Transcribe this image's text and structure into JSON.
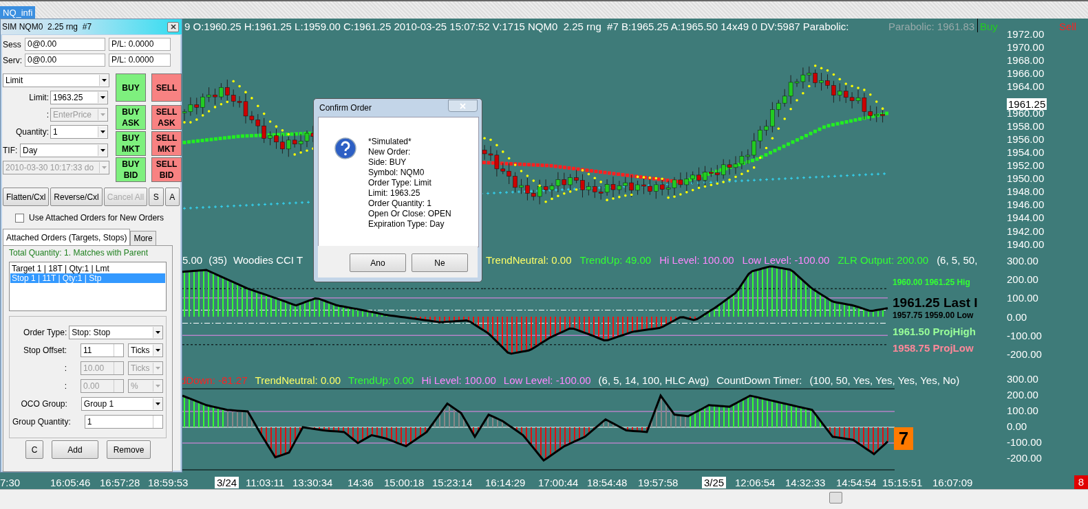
{
  "tabs": [
    {
      "label": "NQ_infi",
      "selected": true
    }
  ],
  "chart": {
    "header": {
      "quote": "9 O:1960.25 H:1961.25 L:1959.00 C:1961.25 2010-03-25 15:07:52 V:1715 NQM0  2.25 rng  #7 B:1965.25 A:1965.50 14x49 0 DV:5987 Parabolic:",
      "parabolic": "Parabolic: 1961.83",
      "buy": "Buy",
      "sell": "Sell"
    },
    "price_axis": [
      "1972.00",
      "1970.00",
      "1968.00",
      "1966.00",
      "1964.00",
      "1960.00",
      "1958.00",
      "1956.00",
      "1954.00",
      "1952.00",
      "1950.00",
      "1948.00",
      "1946.00",
      "1944.00",
      "1942.00",
      "1940.00"
    ],
    "last_price": "1961.25",
    "cci_panel": {
      "legend_left": [
        {
          "text": "5.00",
          "color": "#ffffff"
        },
        {
          "text": "(35)",
          "color": "#ffffff"
        },
        {
          "text": "Woodies CCI T",
          "color": "#ffffff"
        }
      ],
      "legend_right": [
        {
          "text": "TrendNeutral: 0.00",
          "color": "#ffff66"
        },
        {
          "text": "TrendUp: 49.00",
          "color": "#33ff33"
        },
        {
          "text": "Hi Level: 100.00",
          "color": "#ff88ff"
        },
        {
          "text": "Low Level: -100.00",
          "color": "#ff88ff"
        },
        {
          "text": "ZLR Output: 200.00",
          "color": "#33ff33"
        },
        {
          "text": "(6, 5, 50,",
          "color": "#ffffff"
        }
      ],
      "axis": [
        "300.00",
        "200.00",
        "100.00",
        "0.00",
        "-100.00",
        "-200.00"
      ],
      "labels": [
        {
          "text": "1960.00 1961.25 Hig",
          "color": "#33ff33",
          "kind": "small"
        },
        {
          "text": "1961.25 Last I",
          "color": "#000000",
          "kind": "large"
        },
        {
          "text": "1957.75 1959.00 Low",
          "color": "#000000",
          "kind": "small"
        },
        {
          "text": "1961.50 ProjHigh",
          "color": "#99ff99",
          "kind": "medium"
        },
        {
          "text": "1958.75 ProjLow",
          "color": "#ff8899",
          "kind": "medium"
        }
      ]
    },
    "trend_panel": {
      "legend": [
        {
          "text": "dDown: -81.27",
          "color": "#ff2020"
        },
        {
          "text": "TrendNeutral: 0.00",
          "color": "#ffff66"
        },
        {
          "text": "TrendUp: 0.00",
          "color": "#33ff33"
        },
        {
          "text": "Hi Level: 100.00",
          "color": "#ff88ff"
        },
        {
          "text": "Low Level: -100.00",
          "color": "#ff88ff"
        },
        {
          "text": "(6, 5, 14, 100, HLC Avg)",
          "color": "#ffffff"
        },
        {
          "text": "CountDown Timer:",
          "color": "#ffffff"
        },
        {
          "text": "(100, 50, Yes, Yes, Yes, Yes, No)",
          "color": "#ffffff"
        }
      ],
      "axis": [
        "300.00",
        "200.00",
        "100.00",
        "0.00",
        "-100.00",
        "-200.00"
      ],
      "countdown": "7"
    },
    "time_axis": [
      {
        "text": "7:30",
        "kind": "time"
      },
      {
        "text": "16:05:46",
        "kind": "time"
      },
      {
        "text": "16:57:28",
        "kind": "time"
      },
      {
        "text": "18:59:53",
        "kind": "time"
      },
      {
        "text": "3/24",
        "kind": "date"
      },
      {
        "text": "11:03:11",
        "kind": "time"
      },
      {
        "text": "13:30:34",
        "kind": "time"
      },
      {
        "text": "14:36",
        "kind": "time"
      },
      {
        "text": "15:00:18",
        "kind": "time"
      },
      {
        "text": "15:23:14",
        "kind": "time"
      },
      {
        "text": "16:14:29",
        "kind": "time"
      },
      {
        "text": "17:00:44",
        "kind": "time"
      },
      {
        "text": "18:54:48",
        "kind": "time"
      },
      {
        "text": "19:57:58",
        "kind": "time"
      },
      {
        "text": "3/25",
        "kind": "date"
      },
      {
        "text": "12:06:54",
        "kind": "time"
      },
      {
        "text": "14:32:33",
        "kind": "time"
      },
      {
        "text": "14:54:54",
        "kind": "time"
      },
      {
        "text": "15:15:51",
        "kind": "time"
      },
      {
        "text": "16:07:09",
        "kind": "time"
      }
    ],
    "corner_badge": "8"
  },
  "order_window": {
    "title": "SIM NQM0  2.25 rng  #7",
    "position_rows": [
      {
        "label": "Sess",
        "position": "0@0.00",
        "pl": "P/L: 0.0000"
      },
      {
        "label": "Serv:",
        "position": "0@0.00",
        "pl": "P/L: 0.0000"
      }
    ],
    "order_type": "Limit",
    "fields": [
      {
        "label": "Limit:",
        "value": "1963.25",
        "disabled": false
      },
      {
        "label": ":",
        "value": "EnterPrice",
        "disabled": true
      },
      {
        "label": "Quantity:",
        "value": "1",
        "disabled": false
      }
    ],
    "tif": {
      "label": "TIF:",
      "value": "Day"
    },
    "expiry": {
      "value": "2010-03-30 10:17:33 do",
      "disabled": true
    },
    "trade_buttons": [
      {
        "label": "BUY",
        "kind": "buy"
      },
      {
        "label": "SELL",
        "kind": "sell"
      },
      {
        "label": "BUY ASK",
        "kind": "buy"
      },
      {
        "label": "SELL ASK",
        "kind": "sell"
      },
      {
        "label": "BUY MKT",
        "kind": "buy"
      },
      {
        "label": "SELL MKT",
        "kind": "sell"
      },
      {
        "label": "BUY BID",
        "kind": "buy"
      },
      {
        "label": "SELL BID",
        "kind": "sell"
      }
    ],
    "action_buttons": [
      {
        "label": "Flatten/Cxl",
        "disabled": false
      },
      {
        "label": "Reverse/Cxl",
        "disabled": false
      },
      {
        "label": "Cancel All",
        "disabled": true
      },
      {
        "label": "S",
        "disabled": false
      },
      {
        "label": "A",
        "disabled": false
      }
    ],
    "use_attached": {
      "label": "Use Attached Orders for New Orders",
      "checked": false
    },
    "tabs": [
      {
        "label": "Attached Orders (Targets, Stops)",
        "selected": true
      },
      {
        "label": "More",
        "selected": false
      }
    ],
    "total_quantity": "Total Quantity: 1. Matches with Parent",
    "attached_orders": [
      {
        "text": "Target 1 | 18T | Qty:1 | Lmt",
        "selected": false
      },
      {
        "text": "Stop 1 | 11T | Qty:1 | Stp",
        "selected": true
      }
    ],
    "order_type_field": {
      "label": "Order Type:",
      "value": "Stop: Stop"
    },
    "offsets": [
      {
        "label": "Stop Offset:",
        "value": "11",
        "unit": "Ticks",
        "disabled": false
      },
      {
        "label": ":",
        "value": "10.00",
        "unit": "Ticks",
        "disabled": true
      },
      {
        "label": ":",
        "value": "0.00",
        "unit": "%",
        "disabled": true
      }
    ],
    "oco_group": {
      "label": "OCO Group:",
      "value": "Group 1"
    },
    "group_quantity": {
      "label": "Group Quantity:",
      "value": "1"
    },
    "bottom_buttons": [
      "C",
      "Add",
      "Remove"
    ]
  },
  "dialog": {
    "title": "Confirm Order",
    "lines": [
      "*Simulated*",
      "New Order:",
      "Side: BUY",
      "Symbol: NQM0",
      "Order Type: Limit",
      "Limit: 1963.25",
      "Order Quantity: 1",
      "Open Or Close: OPEN",
      "Expiration Type: Day"
    ],
    "buttons": [
      "Ano",
      "Ne"
    ]
  }
}
